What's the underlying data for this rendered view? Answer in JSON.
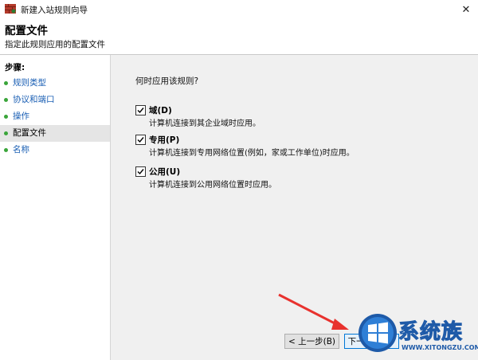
{
  "window": {
    "title": "新建入站规则向导",
    "close_glyph": "✕"
  },
  "header": {
    "title": "配置文件",
    "subtitle": "指定此规则应用的配置文件"
  },
  "sidebar": {
    "heading": "步骤:",
    "items": [
      {
        "label": "规则类型",
        "current": false
      },
      {
        "label": "协议和端口",
        "current": false
      },
      {
        "label": "操作",
        "current": false
      },
      {
        "label": "配置文件",
        "current": true
      },
      {
        "label": "名称",
        "current": false
      }
    ]
  },
  "main": {
    "question": "何时应用该规则?",
    "options": [
      {
        "label": "域(D)",
        "description": "计算机连接到其企业域时应用。",
        "checked": true
      },
      {
        "label": "专用(P)",
        "description": "计算机连接到专用网络位置(例如，家或工作单位)时应用。",
        "checked": true
      },
      {
        "label": "公用(U)",
        "description": "计算机连接到公用网络位置时应用。",
        "checked": true
      }
    ]
  },
  "footer": {
    "back_label": "< 上一步(B)",
    "next_label": "下一步(N) >"
  },
  "watermark": {
    "title": "系统族",
    "url": "WWW.XITONGZU.COM"
  },
  "colors": {
    "link": "#1a5fb4",
    "step_dot": "#3aa53a",
    "arrow": "#e8322e",
    "accent": "#0078d7"
  }
}
